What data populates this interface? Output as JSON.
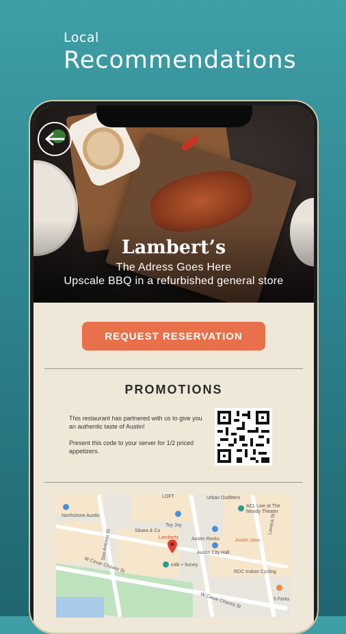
{
  "header": {
    "small": "Local",
    "big": "Recommendations"
  },
  "restaurant": {
    "name": "Lambert’s",
    "address": "The Adress Goes Here",
    "tagline": "Upscale BBQ in a refurbished general store"
  },
  "actions": {
    "reserve_label": "REQUEST RESERVATION"
  },
  "promotions": {
    "title": "PROMOTIONS",
    "text1": "This restaurant has partnered with us to give you an authentic taste of Austin!",
    "text2": "Present this code to your server for 1/2 priced appetizers."
  },
  "map": {
    "labels": {
      "northshore": "Northshore Austin",
      "urban": "Urban Outfitters",
      "acl": "ACL Live at The Moody Theater",
      "toy": "Toy Joy",
      "sikara": "Sikara & Co",
      "lamberts": "Lamberts",
      "austin_rocks": "Austin Rocks",
      "java": "Austin Java",
      "city_hall": "Austin City Hall",
      "milk": "milk + honey",
      "rdc": "RDC Indoor Cycling",
      "forks": "5 Forks",
      "cesar1": "W Cesar Chavez St",
      "cesar2": "W Cesar Chavez St",
      "lavaca": "Lavaca St",
      "san_antonio": "San Antonio St",
      "loft": "LOFT"
    }
  },
  "icons": {
    "back": "back-arrow-icon",
    "qr": "qr-code-icon",
    "map_pin": "map-pin-icon"
  },
  "colors": {
    "accent": "#e8704a",
    "panel": "#efe8d8",
    "background": "#2f8590"
  }
}
